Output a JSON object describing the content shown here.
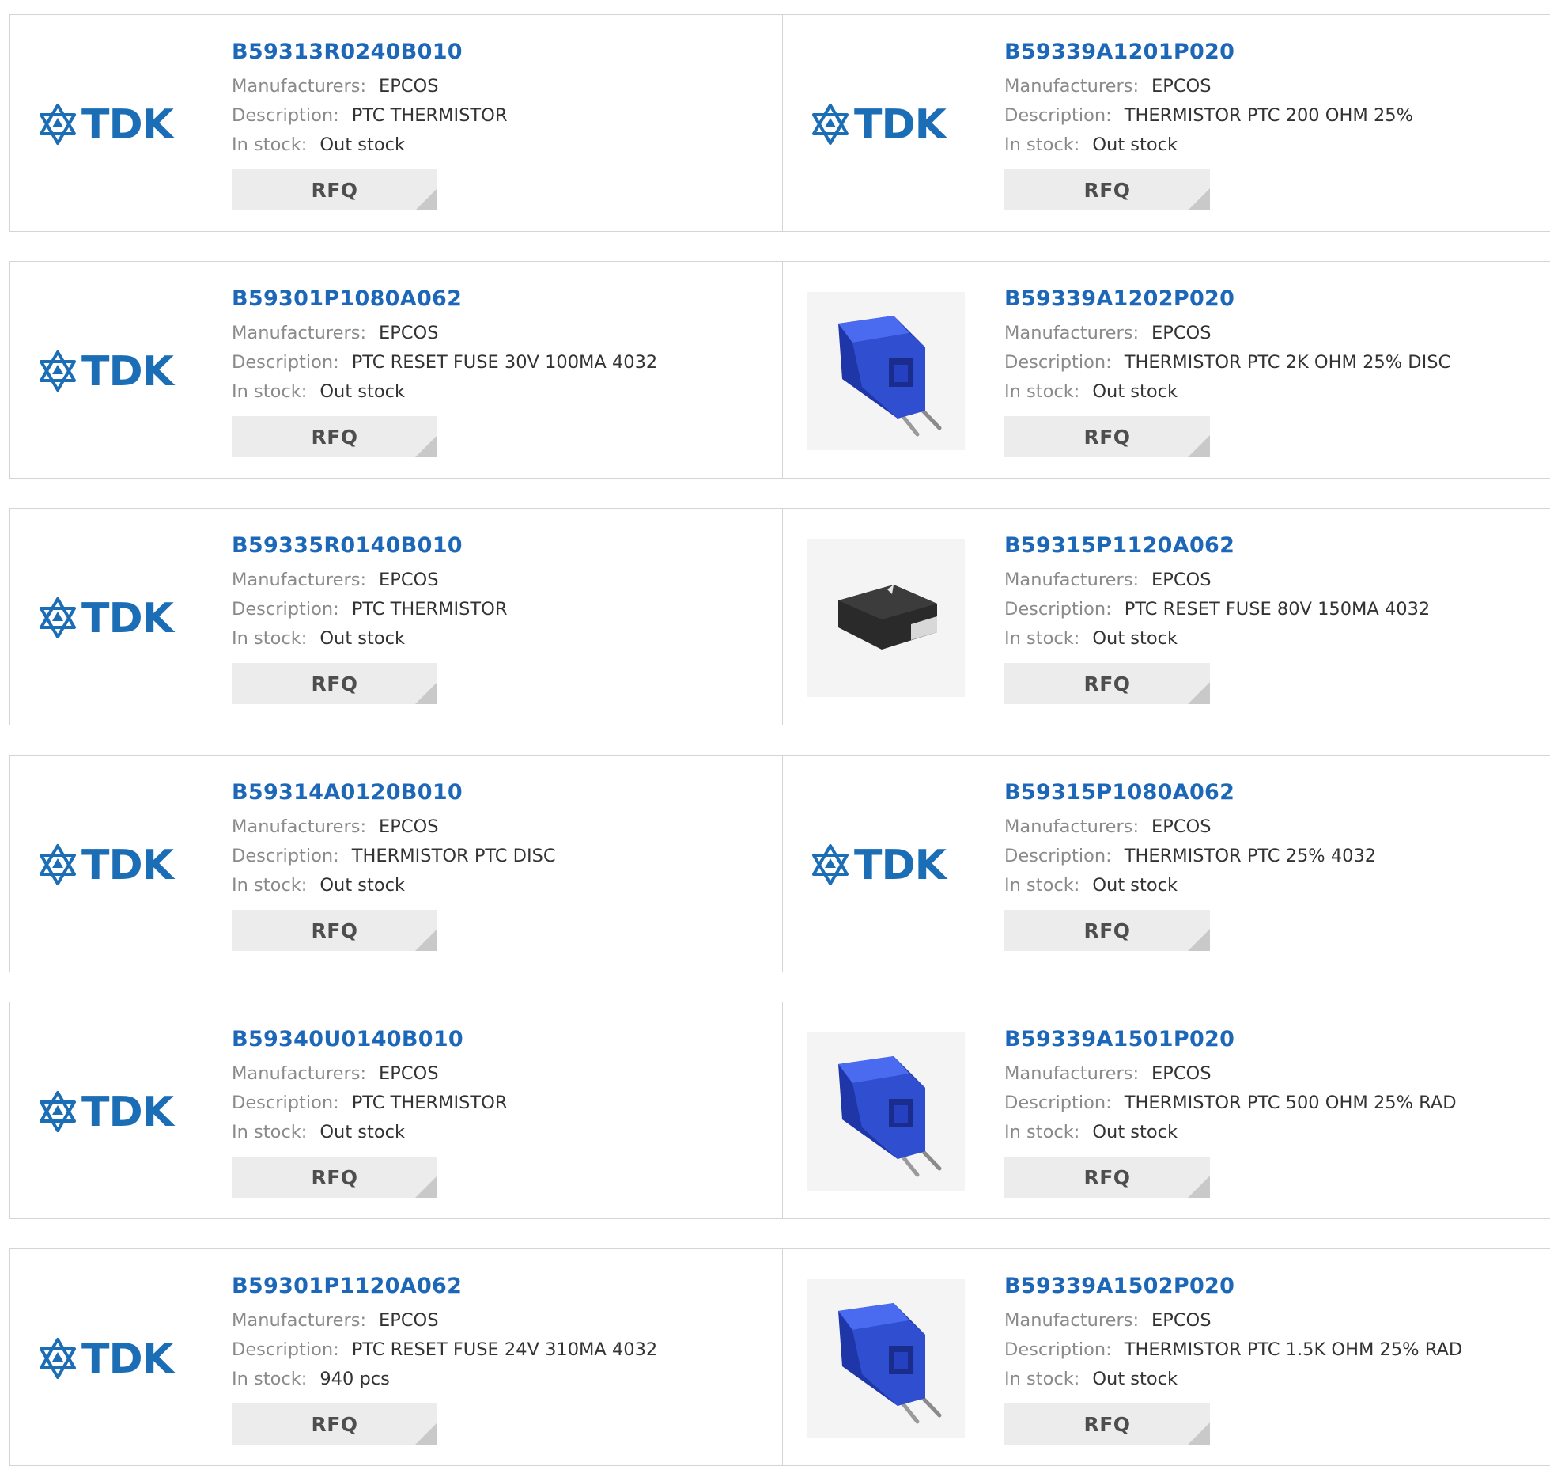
{
  "labels": {
    "manufacturers": "Manufacturers:",
    "description": "Description:",
    "in_stock": "In stock:",
    "rfq": "RFQ"
  },
  "logo_text": "TDK",
  "colors": {
    "link": "#1d67b8",
    "tdk_blue": "#1b6db5",
    "component_blue": "#2f4fd0",
    "rfq_bg": "#ececec",
    "border": "#d4d4d4"
  },
  "products": [
    {
      "part": "B59313R0240B010",
      "manufacturer": "EPCOS",
      "description": "PTC THERMISTOR",
      "stock": "Out stock",
      "image": "tdk-logo"
    },
    {
      "part": "B59339A1201P020",
      "manufacturer": "EPCOS",
      "description": "THERMISTOR PTC 200 OHM 25%",
      "stock": "Out stock",
      "image": "tdk-logo"
    },
    {
      "part": "B59301P1080A062",
      "manufacturer": "EPCOS",
      "description": "PTC RESET FUSE 30V 100MA 4032",
      "stock": "Out stock",
      "image": "tdk-logo"
    },
    {
      "part": "B59339A1202P020",
      "manufacturer": "EPCOS",
      "description": "THERMISTOR PTC 2K OHM 25% DISC",
      "stock": "Out stock",
      "image": "radial-thermistor-photo"
    },
    {
      "part": "B59335R0140B010",
      "manufacturer": "EPCOS",
      "description": "PTC THERMISTOR",
      "stock": "Out stock",
      "image": "tdk-logo"
    },
    {
      "part": "B59315P1120A062",
      "manufacturer": "EPCOS",
      "description": "PTC RESET FUSE 80V 150MA 4032",
      "stock": "Out stock",
      "image": "smd-fuse-photo"
    },
    {
      "part": "B59314A0120B010",
      "manufacturer": "EPCOS",
      "description": "THERMISTOR PTC DISC",
      "stock": "Out stock",
      "image": "tdk-logo"
    },
    {
      "part": "B59315P1080A062",
      "manufacturer": "EPCOS",
      "description": "THERMISTOR PTC 25% 4032",
      "stock": "Out stock",
      "image": "tdk-logo"
    },
    {
      "part": "B59340U0140B010",
      "manufacturer": "EPCOS",
      "description": "PTC THERMISTOR",
      "stock": "Out stock",
      "image": "tdk-logo"
    },
    {
      "part": "B59339A1501P020",
      "manufacturer": "EPCOS",
      "description": "THERMISTOR PTC 500 OHM 25% RAD",
      "stock": "Out stock",
      "image": "radial-thermistor-photo"
    },
    {
      "part": "B59301P1120A062",
      "manufacturer": "EPCOS",
      "description": "PTC RESET FUSE 24V 310MA 4032",
      "stock": "940 pcs",
      "image": "tdk-logo"
    },
    {
      "part": "B59339A1502P020",
      "manufacturer": "EPCOS",
      "description": "THERMISTOR PTC 1.5K OHM 25% RAD",
      "stock": "Out stock",
      "image": "radial-thermistor-photo"
    }
  ]
}
